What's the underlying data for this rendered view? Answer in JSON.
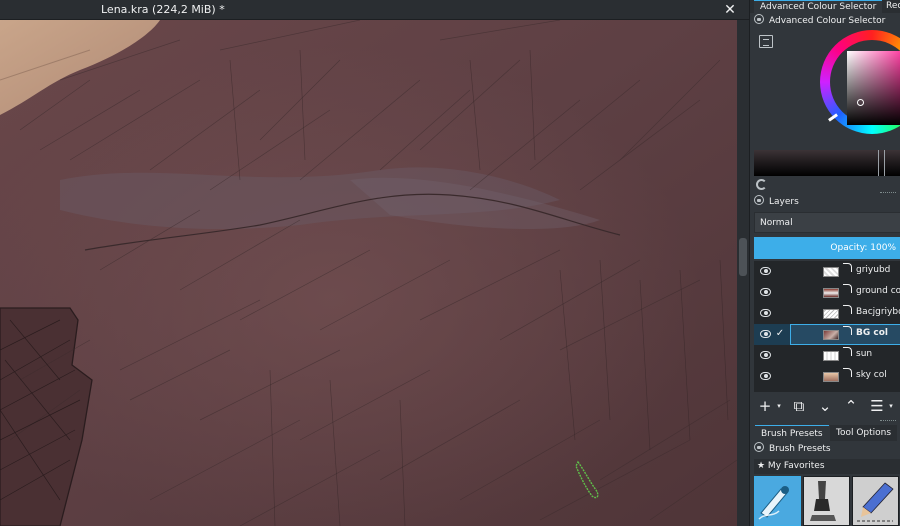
{
  "document": {
    "title": "Lena.kra (224,2 MiB) *",
    "close_glyph": "✕"
  },
  "docker": {
    "tabs": [
      "Advanced Colour Selector",
      "Rec"
    ],
    "colour_selector": {
      "title": "Advanced Colour Selector",
      "current_color": "#7b1f4c"
    },
    "layers": {
      "title": "Layers",
      "blend_mode": "Normal",
      "opacity_label": "Opacity:  100%",
      "items": [
        {
          "name": "griyubd",
          "visible": true,
          "selected": false,
          "checked": false
        },
        {
          "name": "ground col",
          "visible": true,
          "selected": false,
          "checked": false
        },
        {
          "name": "Bacjgriybd",
          "visible": true,
          "selected": false,
          "checked": false
        },
        {
          "name": "BG col",
          "visible": true,
          "selected": true,
          "checked": true
        },
        {
          "name": "sun",
          "visible": true,
          "selected": false,
          "checked": false
        },
        {
          "name": "sky col",
          "visible": true,
          "selected": false,
          "checked": false
        }
      ],
      "toolbar": {
        "add": "+",
        "caret": "▾",
        "duplicate": "⧉",
        "move_down": "⌄",
        "move_up": "⌃",
        "properties": "☰"
      },
      "check_glyph": "✓"
    },
    "brush_presets": {
      "tabs": [
        "Brush Presets",
        "Tool Options"
      ],
      "title": "Brush Presets",
      "favorites_label": "★ My Favorites"
    }
  },
  "colors": {
    "accent": "#3daee9",
    "canvas_base": "#5d4044",
    "panel_bg": "#31363b"
  }
}
